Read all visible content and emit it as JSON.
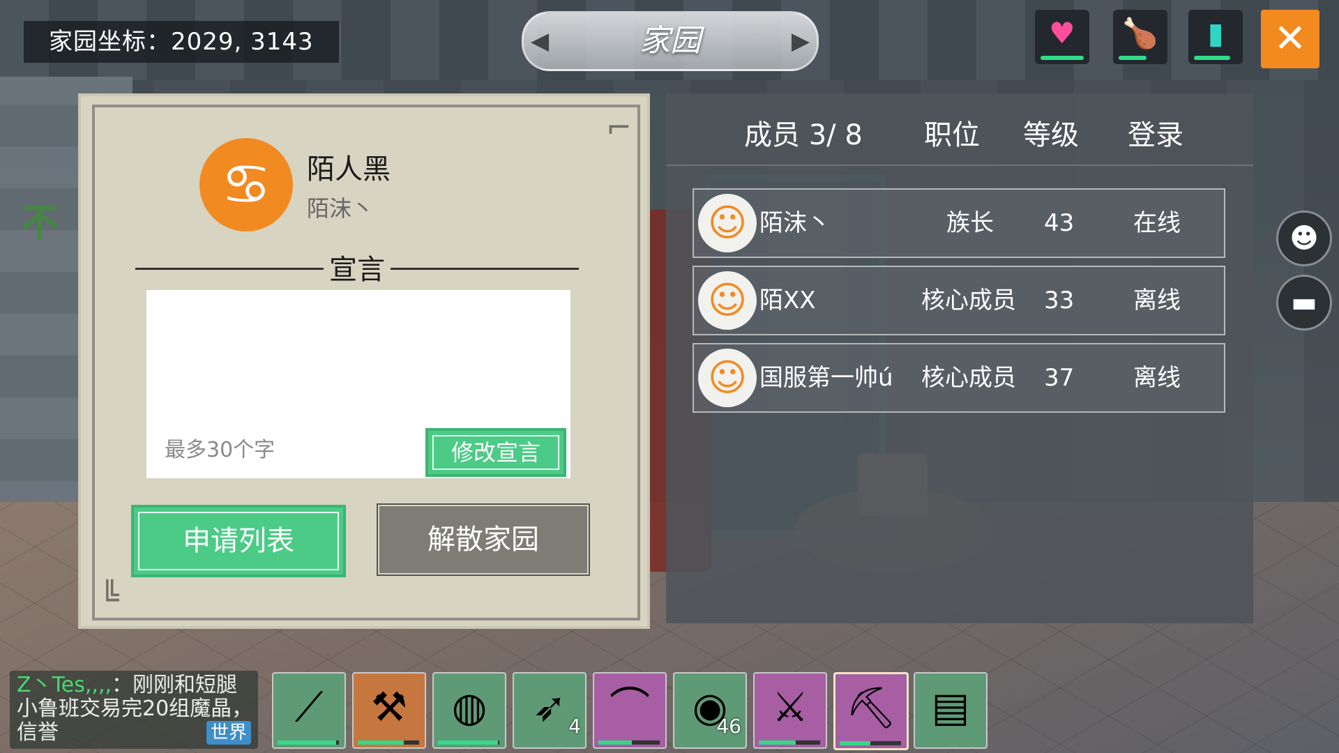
{
  "hud": {
    "coords": "家园坐标：2029, 3143",
    "title": "家园",
    "status_icons": [
      {
        "icon": "heart-icon",
        "color": "#ff4f9a"
      },
      {
        "icon": "food-drumstick-icon",
        "color": "#ffd21e"
      },
      {
        "icon": "water-cup-icon",
        "color": "#2ed7c4"
      }
    ],
    "close_icon": "close-icon"
  },
  "home": {
    "family_name": "陌人黑",
    "leader": "陌沫丶",
    "declaration_title": "宣言",
    "declaration_placeholder": "最多30个字",
    "modify_button": "修改宣言",
    "apply_list_button": "申请列表",
    "disband_button": "解散家园"
  },
  "members": {
    "header": {
      "count": "成员 3/ 8",
      "position": "职位",
      "level": "等级",
      "login": "登录"
    },
    "rows": [
      {
        "name": "陌沫丶",
        "role": "族长",
        "level": "43",
        "status": "在线"
      },
      {
        "name": "陌XX",
        "role": "核心成员",
        "level": "33",
        "status": "离线"
      },
      {
        "name": "国服第一帅ú",
        "role": "核心成员",
        "level": "37",
        "status": "离线"
      }
    ]
  },
  "side": {
    "emote_icon": "smiley-icon",
    "chat_icon": "chat-bubble-icon"
  },
  "chat": {
    "sender": "Z丶Tes,,,,",
    "message": "：刚刚和短腿小鲁班交易完20组魔晶，信誉",
    "channel": "世界"
  },
  "hotbar": [
    {
      "item": "spear-icon",
      "count": "",
      "durability": 0.95,
      "bg": "#5f9a76"
    },
    {
      "item": "ice-axe-icon",
      "count": "",
      "durability": 0.75,
      "bg": "#c5773f"
    },
    {
      "item": "waterskin-icon",
      "count": "",
      "durability": 0.98,
      "bg": "#5f9a76"
    },
    {
      "item": "arrow-icon",
      "count": "4",
      "durability": 0,
      "bg": "#5f9a76"
    },
    {
      "item": "bow-icon",
      "count": "",
      "durability": 0.55,
      "bg": "#a75ea3"
    },
    {
      "item": "steak-icon",
      "count": "46",
      "durability": 0,
      "bg": "#5f9a76"
    },
    {
      "item": "crystal-sword-icon",
      "count": "",
      "durability": 0.6,
      "bg": "#a75ea3"
    },
    {
      "item": "pickaxe-icon",
      "count": "",
      "durability": 0.5,
      "bg": "#a75ea3"
    },
    {
      "item": "treasure-map-icon",
      "count": "",
      "durability": 0,
      "bg": "#5f9a76"
    }
  ]
}
